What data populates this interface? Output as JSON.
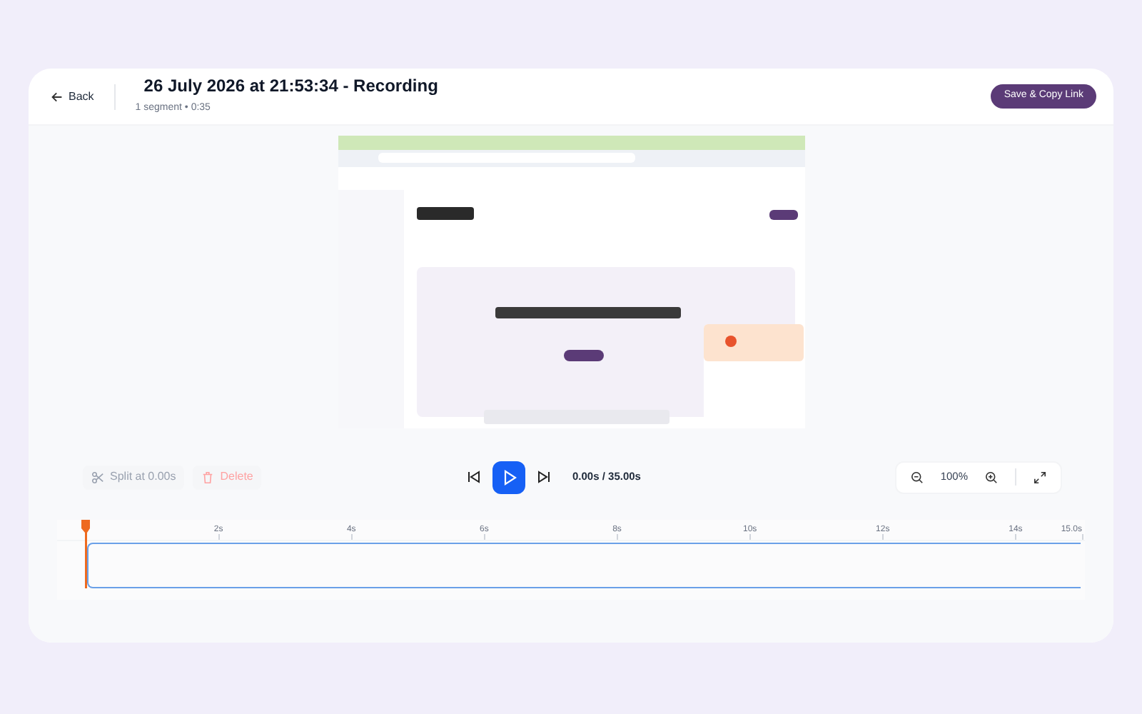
{
  "header": {
    "back": "Back",
    "title": "26 July 2026 at 21:53:34 - Recording",
    "subtitle": "1 segment • 0:35",
    "action": "Save & Copy Link"
  },
  "toolbar": {
    "split": {
      "label": "Split at 0.00s",
      "disabled": true
    },
    "delete": {
      "label": "Delete",
      "disabled": true
    },
    "playing": false,
    "time": "0.00s / 35.00s",
    "zoom": "100%"
  },
  "timeline": {
    "ticks": [
      "2s",
      "4s",
      "6s",
      "8s",
      "10s",
      "12s",
      "14s",
      "15.0s"
    ]
  }
}
